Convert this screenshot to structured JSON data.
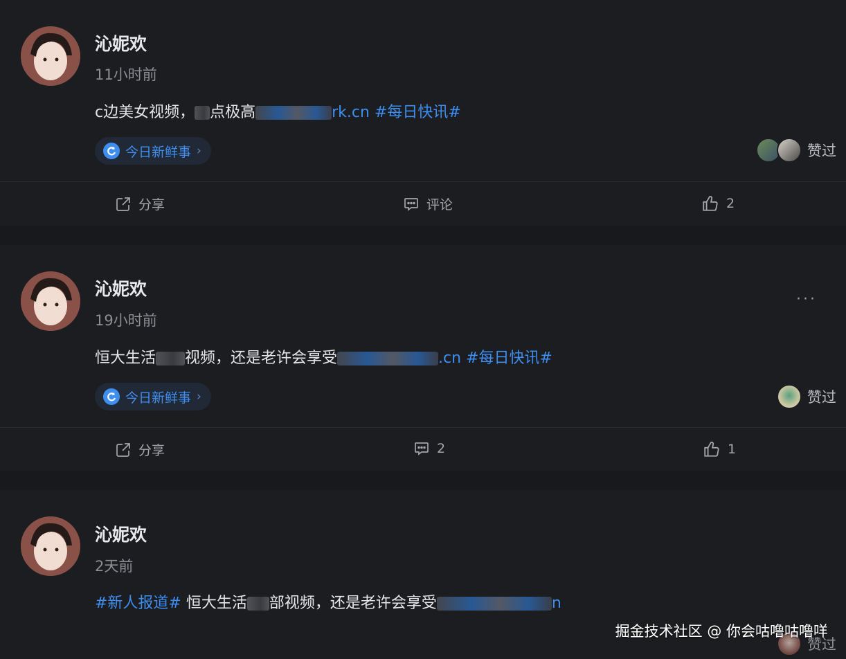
{
  "posts": [
    {
      "author": "沁妮欢",
      "time": "11小时前",
      "text_pre": "c边美女视频，",
      "text_mid": "点极高",
      "link_tail": "rk.cn",
      "hashtag": " #每日快讯#",
      "topic": "今日新鲜事",
      "liked_label": "赞过",
      "actions": {
        "share": "分享",
        "comment": "评论",
        "like_count": "2"
      }
    },
    {
      "author": "沁妮欢",
      "time": "19小时前",
      "text_pre": "恒大生活",
      "text_mid": "视频，还是老许会享受",
      "link_tail": ".cn",
      "hashtag": " #每日快讯#",
      "topic": "今日新鲜事",
      "liked_label": "赞过",
      "actions": {
        "share": "分享",
        "comment_count": "2",
        "like_count": "1"
      }
    },
    {
      "author": "沁妮欢",
      "time": "2天前",
      "hashtag_prefix": "#新人报道#",
      "text_pre": " 恒大生活",
      "text_mid": "部视频，还是老许会享受",
      "link_tail": "n",
      "liked_label": "赞过"
    }
  ],
  "more_menu": "···",
  "watermark": "掘金技术社区 @ 你会咕噜咕噜咩",
  "icons": [
    "share-icon",
    "comment-icon",
    "thumbs-up-icon",
    "topic-icon",
    "chevron-right-icon",
    "more-icon"
  ],
  "colors": {
    "background": "#1c1d20",
    "link": "#3e8ef0",
    "muted": "#8b8e96"
  }
}
